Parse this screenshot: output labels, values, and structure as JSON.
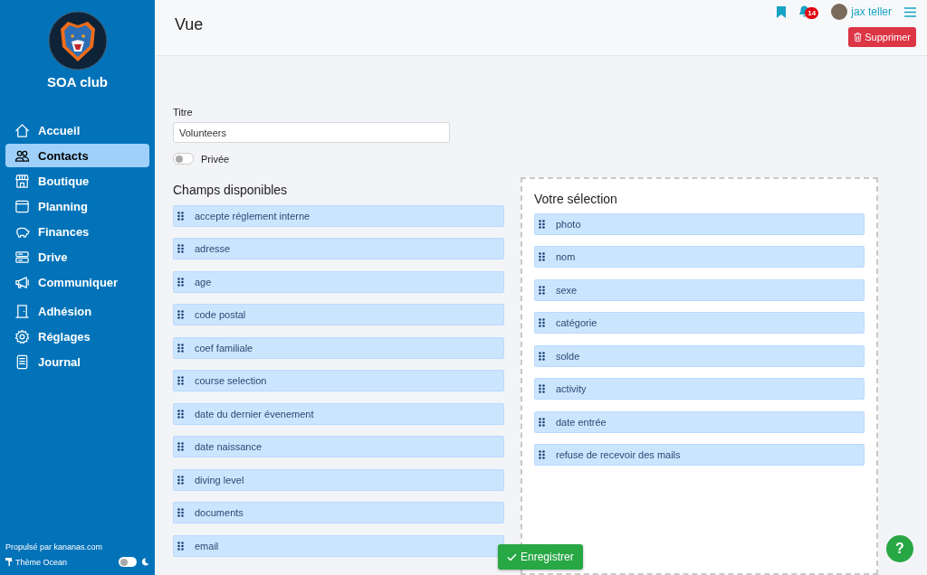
{
  "sidebar": {
    "club_name": "SOA club",
    "items": [
      {
        "label": "Accueil",
        "selected": false
      },
      {
        "label": "Contacts",
        "selected": true
      },
      {
        "label": "Boutique",
        "selected": false
      },
      {
        "label": "Planning",
        "selected": false
      },
      {
        "label": "Finances",
        "selected": false
      },
      {
        "label": "Drive",
        "selected": false
      },
      {
        "label": "Communiquer",
        "selected": false
      },
      {
        "label": "Adhésion",
        "selected": false
      },
      {
        "label": "Réglages",
        "selected": false
      },
      {
        "label": "Journal",
        "selected": false
      }
    ],
    "footer": "Propulsé par kananas.com",
    "theme": "Thème Ocean",
    "dark_mode": false
  },
  "header": {
    "title": "Vue",
    "notifications": "14",
    "user": "jax teller",
    "delete_button": "Supprimer"
  },
  "form": {
    "title_label": "Titre",
    "title_value": "Volunteers",
    "private_label": "Privée",
    "private": false
  },
  "available": {
    "heading": "Champs disponibles",
    "items": [
      "accepte réglement interne",
      "adresse",
      "age",
      "code postal",
      "coef familiale",
      "course selection",
      "date du dernier évenement",
      "date naissance",
      "diving level",
      "documents",
      "email"
    ]
  },
  "selection": {
    "heading": "Votre sélection",
    "items": [
      "photo",
      "nom",
      "sexe",
      "catégorie",
      "solde",
      "activity",
      "date entrée",
      "refuse de recevoir des mails"
    ]
  },
  "save_button": "Enregistrer",
  "help_button": "?"
}
